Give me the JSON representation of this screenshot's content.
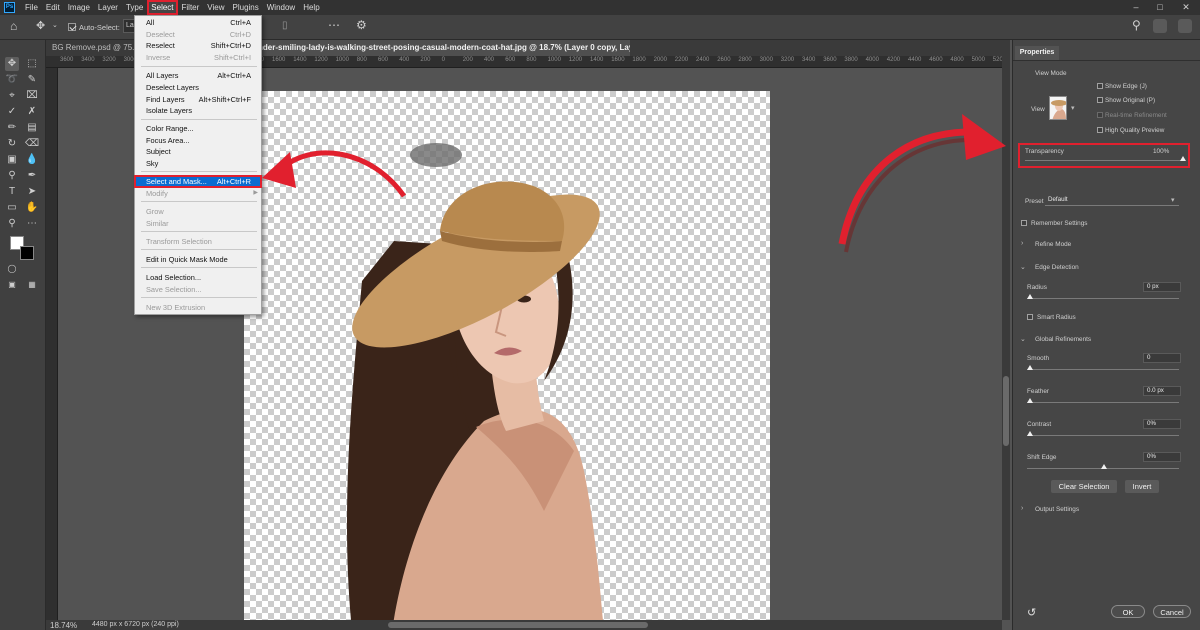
{
  "menubar": {
    "logo": "Ps",
    "items": [
      {
        "label": "File"
      },
      {
        "label": "Edit"
      },
      {
        "label": "Image"
      },
      {
        "label": "Layer"
      },
      {
        "label": "Type"
      },
      {
        "label": "Select"
      },
      {
        "label": "Filter"
      },
      {
        "label": "View"
      },
      {
        "label": "Plugins"
      },
      {
        "label": "Window"
      },
      {
        "label": "Help"
      }
    ],
    "active_index": 5
  },
  "options": {
    "auto_select_label": "Auto-Select:",
    "layer_dropdown": "La"
  },
  "tabs": [
    {
      "label": "BG Remove.psd @ 75.6%"
    },
    {
      "label": "nder-smiling-lady-is-walking-street-posing-casual-modern-coat-hat.jpg @ 18.7% (Layer 0 copy, Layer Mask/8) *"
    }
  ],
  "ruler": [
    "3600",
    "3400",
    "3200",
    "3000",
    "2800",
    "2600",
    "2400",
    "2200",
    "2000",
    "1800",
    "1600",
    "1400",
    "1200",
    "1000",
    "800",
    "600",
    "400",
    "200",
    "0",
    "200",
    "400",
    "600",
    "800",
    "1000",
    "1200",
    "1400",
    "1600",
    "1800",
    "2000",
    "2200",
    "2400",
    "2600",
    "2800",
    "3000",
    "3200",
    "3400",
    "3600",
    "3800",
    "4000",
    "4200",
    "4400",
    "4600",
    "4800",
    "5000",
    "5200",
    "5400",
    "5600",
    "5800",
    "6000"
  ],
  "status": {
    "zoom": "18.74%",
    "dims": "4480 px x 6720 px (240 ppi)"
  },
  "select_menu": {
    "items": [
      {
        "label": "All",
        "shortcut": "Ctrl+A",
        "disabled": false
      },
      {
        "label": "Deselect",
        "shortcut": "Ctrl+D",
        "disabled": true
      },
      {
        "label": "Reselect",
        "shortcut": "Shift+Ctrl+D",
        "disabled": false
      },
      {
        "label": "Inverse",
        "shortcut": "Shift+Ctrl+I",
        "disabled": true
      },
      {
        "label": "All Layers",
        "shortcut": "Alt+Ctrl+A",
        "disabled": false
      },
      {
        "label": "Deselect Layers",
        "shortcut": "",
        "disabled": false
      },
      {
        "label": "Find Layers",
        "shortcut": "Alt+Shift+Ctrl+F",
        "disabled": false
      },
      {
        "label": "Isolate Layers",
        "shortcut": "",
        "disabled": false
      },
      {
        "label": "Color Range...",
        "shortcut": "",
        "disabled": false
      },
      {
        "label": "Focus Area...",
        "shortcut": "",
        "disabled": false
      },
      {
        "label": "Subject",
        "shortcut": "",
        "disabled": false
      },
      {
        "label": "Sky",
        "shortcut": "",
        "disabled": false
      },
      {
        "label": "Select and Mask...",
        "shortcut": "Alt+Ctrl+R",
        "disabled": false
      },
      {
        "label": "Modify",
        "shortcut": "",
        "disabled": true
      },
      {
        "label": "Grow",
        "shortcut": "",
        "disabled": true
      },
      {
        "label": "Similar",
        "shortcut": "",
        "disabled": true
      },
      {
        "label": "Transform Selection",
        "shortcut": "",
        "disabled": true
      },
      {
        "label": "Edit in Quick Mask Mode",
        "shortcut": "",
        "disabled": false
      },
      {
        "label": "Load Selection...",
        "shortcut": "",
        "disabled": false
      },
      {
        "label": "Save Selection...",
        "shortcut": "",
        "disabled": true
      },
      {
        "label": "New 3D Extrusion",
        "shortcut": "",
        "disabled": true
      }
    ],
    "highlighted": "Select and Mask..."
  },
  "properties": {
    "tab": "Properties",
    "view_mode": "View Mode",
    "view_label": "View",
    "show_edge": "Show Edge (J)",
    "show_original": "Show Original (P)",
    "realtime": "Real-time Refinement",
    "hq_preview": "High Quality Preview",
    "transparency_label": "Transparency",
    "transparency_value": "100%",
    "transparency": 1.0,
    "preset_label": "Preset",
    "preset_value": "Default",
    "remember": "Remember Settings",
    "refine_mode": "Refine Mode",
    "edge_detection": "Edge Detection",
    "radius_label": "Radius",
    "radius_value": "0 px",
    "smart_radius": "Smart Radius",
    "global_refinements": "Global Refinements",
    "smooth_label": "Smooth",
    "smooth_value": "0",
    "feather_label": "Feather",
    "feather_value": "0.0 px",
    "contrast_label": "Contrast",
    "contrast_value": "0%",
    "shift_edge_label": "Shift Edge",
    "shift_edge_value": "0%",
    "clear_selection": "Clear Selection",
    "invert": "Invert",
    "output_settings": "Output Settings",
    "ok": "OK",
    "cancel": "Cancel"
  },
  "colors": {
    "accent_red": "#e1202e",
    "menu_highlight": "#0a6cd1",
    "coat": "#d9a88e",
    "hat": "#c79a63",
    "hair": "#3a2419"
  }
}
